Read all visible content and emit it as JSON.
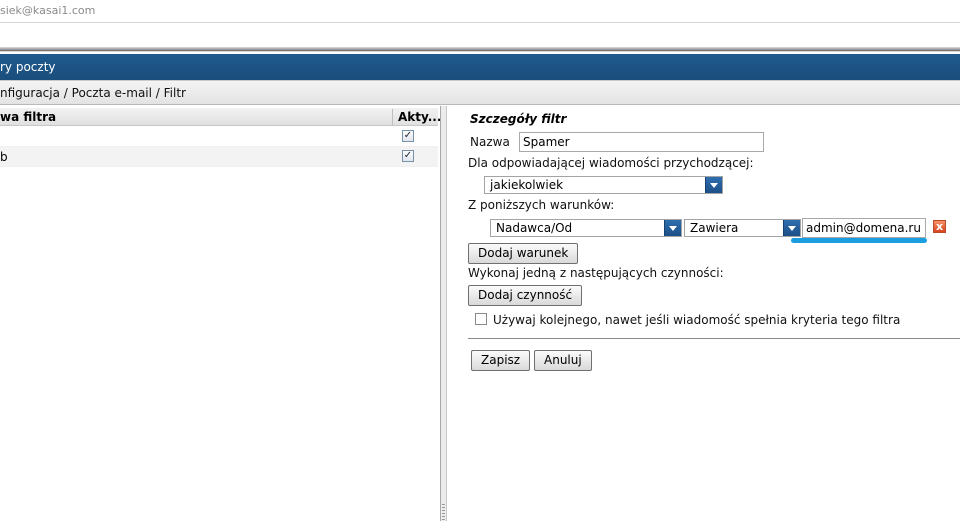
{
  "header": {
    "user_email": "siek@kasai1.com"
  },
  "titlebar": {
    "title": "ry poczty"
  },
  "breadcrumb": {
    "path": "nfiguracja / Poczta e-mail / Filtr"
  },
  "filter_list": {
    "columns": [
      "wa filtra",
      "Akty..."
    ],
    "rows": [
      {
        "name": "",
        "active": true
      },
      {
        "name": "b",
        "active": true
      }
    ],
    "checkmark_glyph": "✓"
  },
  "details": {
    "title": "Szczegóły filtr",
    "name_label": "Nazwa",
    "name_value": "Spamer",
    "match_label": "Dla odpowiadającej wiadomości przychodzącej:",
    "match_value": "jakiekolwiek",
    "conditions_label": "Z poniższych warunków:",
    "condition": {
      "field": "Nadawca/Od",
      "operator": "Zawiera",
      "value": "admin@domena.ru"
    },
    "add_condition_label": "Dodaj warunek",
    "actions_label": "Wykonaj jedną z następujących czynności:",
    "add_action_label": "Dodaj czynność",
    "continue_checkbox_label": "Używaj kolejnego, nawet jeśli wiadomość spełnia kryteria tego filtra",
    "continue_checked": false,
    "save_label": "Zapisz",
    "cancel_label": "Anuluj",
    "delete_glyph": "x"
  },
  "colors": {
    "titlebar": "#1f5a8e",
    "select_arrow": "#2f6fb0",
    "highlight_underline": "#1a9ee0",
    "delete_icon": "#d9441e",
    "teal_row_text": "#0aa3a3"
  }
}
